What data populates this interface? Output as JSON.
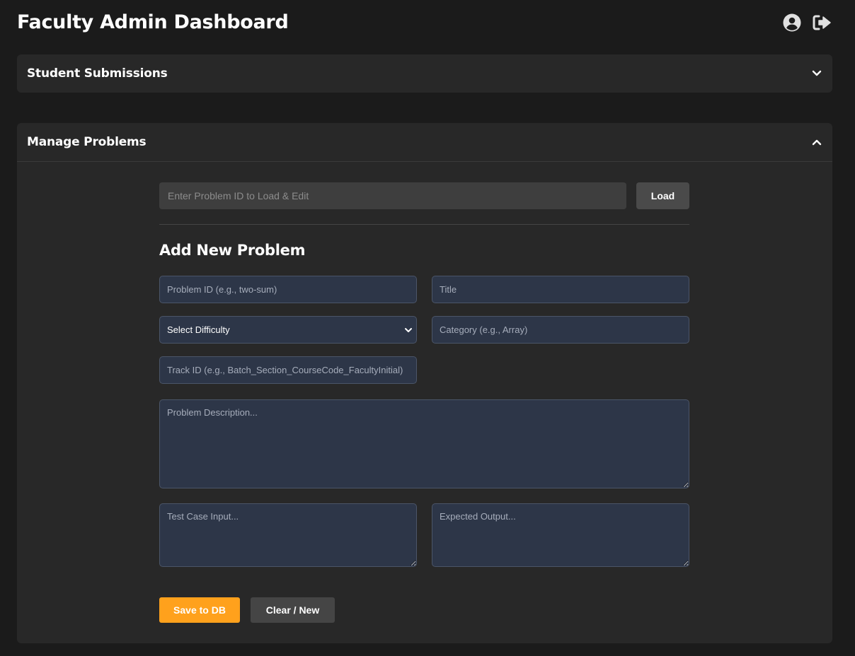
{
  "header": {
    "title": "Faculty Admin Dashboard",
    "profile_icon": "user-circle-icon",
    "logout_icon": "sign-out-icon"
  },
  "submissions": {
    "title": "Student Submissions",
    "toggle_icon": "chevron-down-icon"
  },
  "problems": {
    "title": "Manage Problems",
    "toggle_icon": "chevron-up-icon",
    "load_placeholder": "Enter Problem ID to Load & Edit",
    "load_label": "Load",
    "form_title": "Add New Problem",
    "fields": {
      "problem_id_placeholder": "Problem ID (e.g., two-sum)",
      "title_placeholder": "Title",
      "difficulty_selected": "Select Difficulty",
      "category_placeholder": "Category (e.g., Array)",
      "track_id_placeholder": "Track ID (e.g., Batch_Section_CourseCode_FacultyInitial)",
      "description_placeholder": "Problem Description...",
      "test_input_placeholder": "Test Case Input...",
      "expected_output_placeholder": "Expected Output..."
    },
    "save_label": "Save to DB",
    "clear_label": "Clear / New"
  },
  "colors": {
    "background": "#1b1b1b",
    "panel": "#282828",
    "field": "#2d3648",
    "accent": "#ffa11c"
  }
}
